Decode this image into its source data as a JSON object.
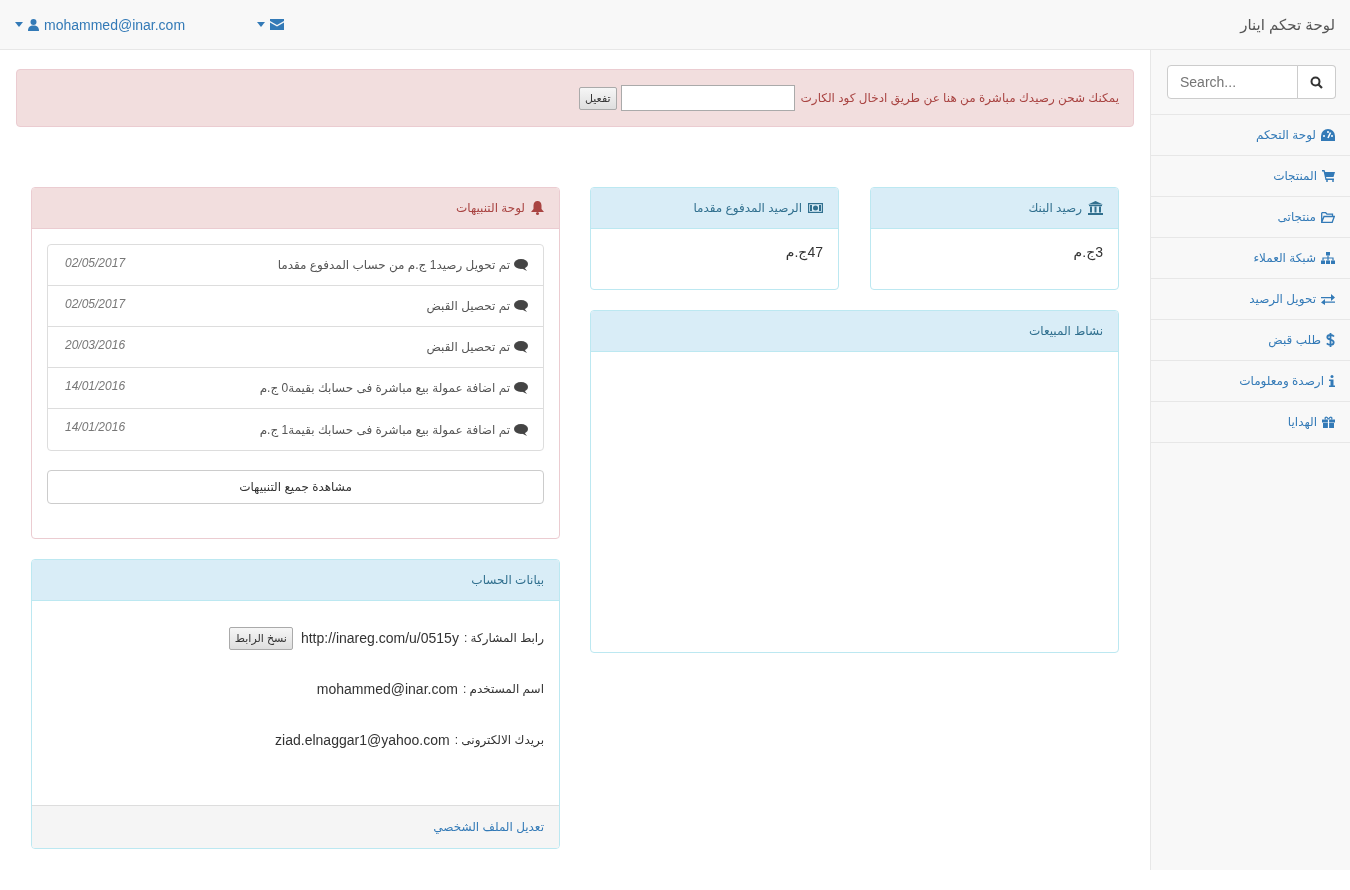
{
  "navbar": {
    "brand": "لوحة تحكم اينار",
    "user": "mohammed@inar.com"
  },
  "sidebar": {
    "search": {
      "placeholder": "Search..."
    },
    "items": [
      {
        "label": "لوحة التحكم"
      },
      {
        "label": "المنتجات"
      },
      {
        "label": "منتجاتى"
      },
      {
        "label": "شبكة العملاء"
      },
      {
        "label": "تحويل الرصيد"
      },
      {
        "label": "طلب قبض"
      },
      {
        "label": "ارصدة ومعلومات"
      },
      {
        "label": "الهدايا"
      }
    ]
  },
  "alert": {
    "text": "يمكنك شحن رصيدك مباشرة من هنا عن طريق ادخال كود الكارت",
    "button": "تفعيل"
  },
  "balances": [
    {
      "title": "رصيد البنك",
      "value": "3ج.م"
    },
    {
      "title": "الرصيد المدفوع مقدما",
      "value": "47ج.م"
    }
  ],
  "sales_panel": {
    "title": "نشاط المبيعات"
  },
  "notifications": {
    "title": "لوحة التنبيهات",
    "items": [
      {
        "text": "تم تحويل رصيد1 ج.م من حساب المدفوع مقدما",
        "date": "02/05/2017"
      },
      {
        "text": "تم تحصيل القبض",
        "date": "02/05/2017"
      },
      {
        "text": "تم تحصيل القبض",
        "date": "20/03/2016"
      },
      {
        "text": "تم اضافة عمولة بيع مباشرة فى حسابك بقيمة0 ج.م",
        "date": "14/01/2016"
      },
      {
        "text": "تم اضافة عمولة بيع مباشرة فى حسابك بقيمة1 ج.م",
        "date": "14/01/2016"
      }
    ],
    "button": "مشاهدة جميع التنبيهات"
  },
  "account": {
    "title": "بيانات الحساب",
    "rows": [
      {
        "kind": "link",
        "label": "رابط المشاركة :",
        "value": "http://inareg.com/u/0515y",
        "button": "نسخ الرابط"
      },
      {
        "kind": "text",
        "label": "اسم المستخدم :",
        "value": "mohammed@inar.com"
      },
      {
        "kind": "text",
        "label": "بريدك الالكترونى :",
        "value": "ziad.elnaggar1@yahoo.com"
      }
    ],
    "footer_link": "تعديل الملف الشخصي"
  }
}
